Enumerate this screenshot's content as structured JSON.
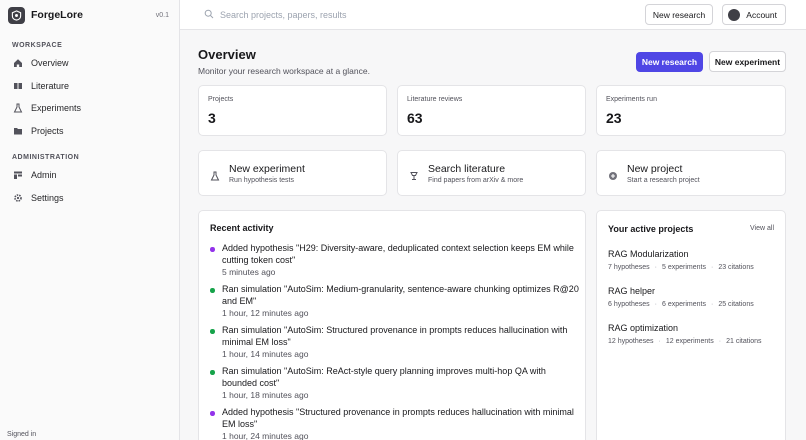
{
  "sidebar": {
    "app_name": "ForgeLore",
    "version": "v0.1",
    "sections": [
      {
        "title": "WORKSPACE",
        "items": [
          {
            "label": "Overview",
            "icon": "home-icon"
          },
          {
            "label": "Literature",
            "icon": "book-icon"
          },
          {
            "label": "Experiments",
            "icon": "flask-icon"
          },
          {
            "label": "Projects",
            "icon": "folder-icon"
          }
        ]
      },
      {
        "title": "ADMINISTRATION",
        "items": [
          {
            "label": "Admin",
            "icon": "admin-icon"
          },
          {
            "label": "Settings",
            "icon": "gear-icon"
          }
        ]
      }
    ],
    "footer": "Signed in"
  },
  "topbar": {
    "search_placeholder": "Search projects, papers, results",
    "new_research_label": "New research",
    "account_label": "Account"
  },
  "overview": {
    "title": "Overview",
    "subtitle": "Monitor your research workspace at a glance.",
    "primary_button": "New research",
    "secondary_button": "New experiment"
  },
  "stats": [
    {
      "label": "Projects",
      "value": "3"
    },
    {
      "label": "Literature reviews",
      "value": "63"
    },
    {
      "label": "Experiments run",
      "value": "23"
    }
  ],
  "quick_actions": [
    {
      "title": "New experiment",
      "subtitle": "Run hypothesis tests",
      "icon": "flask-icon"
    },
    {
      "title": "Search literature",
      "subtitle": "Find papers from arXiv & more",
      "icon": "lamp-icon"
    },
    {
      "title": "New project",
      "subtitle": "Start a research project",
      "icon": "plus-circle-icon"
    }
  ],
  "recent_activity": {
    "title": "Recent activity",
    "items": [
      {
        "text": "Added hypothesis \"H29: Diversity-aware, deduplicated context selection keeps EM while cutting token cost\"",
        "time": "5 minutes ago",
        "color": "#9333ea"
      },
      {
        "text": "Ran simulation \"AutoSim: Medium-granularity, sentence-aware chunking optimizes R@20 and EM\"",
        "time": "1 hour, 12 minutes ago",
        "color": "#16a34a"
      },
      {
        "text": "Ran simulation \"AutoSim: Structured provenance in prompts reduces hallucination with minimal EM loss\"",
        "time": "1 hour, 14 minutes ago",
        "color": "#16a34a"
      },
      {
        "text": "Ran simulation \"AutoSim: ReAct-style query planning improves multi-hop QA with bounded cost\"",
        "time": "1 hour, 18 minutes ago",
        "color": "#16a34a"
      },
      {
        "text": "Added hypothesis \"Structured provenance in prompts reduces hallucination with minimal EM loss\"",
        "time": "1 hour, 24 minutes ago",
        "color": "#9333ea"
      }
    ]
  },
  "active_projects": {
    "title": "Your active projects",
    "view_all": "View all",
    "items": [
      {
        "name": "RAG Modularization",
        "hypotheses": "7 hypotheses",
        "experiments": "5 experiments",
        "citations": "23 citations"
      },
      {
        "name": "RAG helper",
        "hypotheses": "6 hypotheses",
        "experiments": "6 experiments",
        "citations": "25 citations"
      },
      {
        "name": "RAG optimization",
        "hypotheses": "12 hypotheses",
        "experiments": "12 experiments",
        "citations": "21 citations"
      }
    ]
  }
}
